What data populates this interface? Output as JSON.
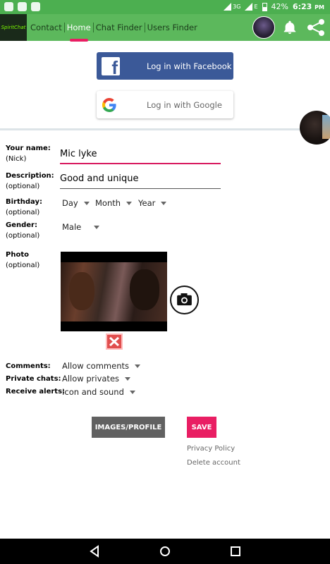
{
  "status_bar": {
    "network_label": "3G",
    "network_label_2": "E",
    "battery": "42%",
    "time": "6:23",
    "time_suffix": "PM"
  },
  "app_bar": {
    "logo_text": "SpiritChat",
    "tabs": [
      {
        "label": "Contact"
      },
      {
        "label": "Home"
      },
      {
        "label": "Chat Finder"
      },
      {
        "label": "Users Finder"
      }
    ],
    "active_tab": "Home",
    "accent_color": "#5cb85c"
  },
  "login": {
    "facebook_label": "Log in with Facebook",
    "google_label": "Log in with Google"
  },
  "form": {
    "name_label": "Your name:",
    "name_sub": "(Nick)",
    "name_value": "Mic lyke",
    "description_label": "Description:",
    "description_sub": "(optional)",
    "description_value": "Good and unique",
    "birthday_label": "Birthday:",
    "birthday_sub": "(optional)",
    "birthday_day": "Day",
    "birthday_month": "Month",
    "birthday_year": "Year",
    "gender_label": "Gender:",
    "gender_sub": "(optional)",
    "gender_value": "Male",
    "photo_label": "Photo",
    "photo_sub": "(optional)",
    "comments_label": "Comments:",
    "comments_value": "Allow comments",
    "private_label": "Private chats:",
    "private_value": "Allow privates",
    "alerts_label": "Receive alerts:",
    "alerts_value": "Icon and sound"
  },
  "actions": {
    "images_label": "IMAGES/PROFILE",
    "save_label": "SAVE",
    "privacy_label": "Privacy Policy",
    "delete_label": "Delete account",
    "save_color": "#e91e63"
  }
}
